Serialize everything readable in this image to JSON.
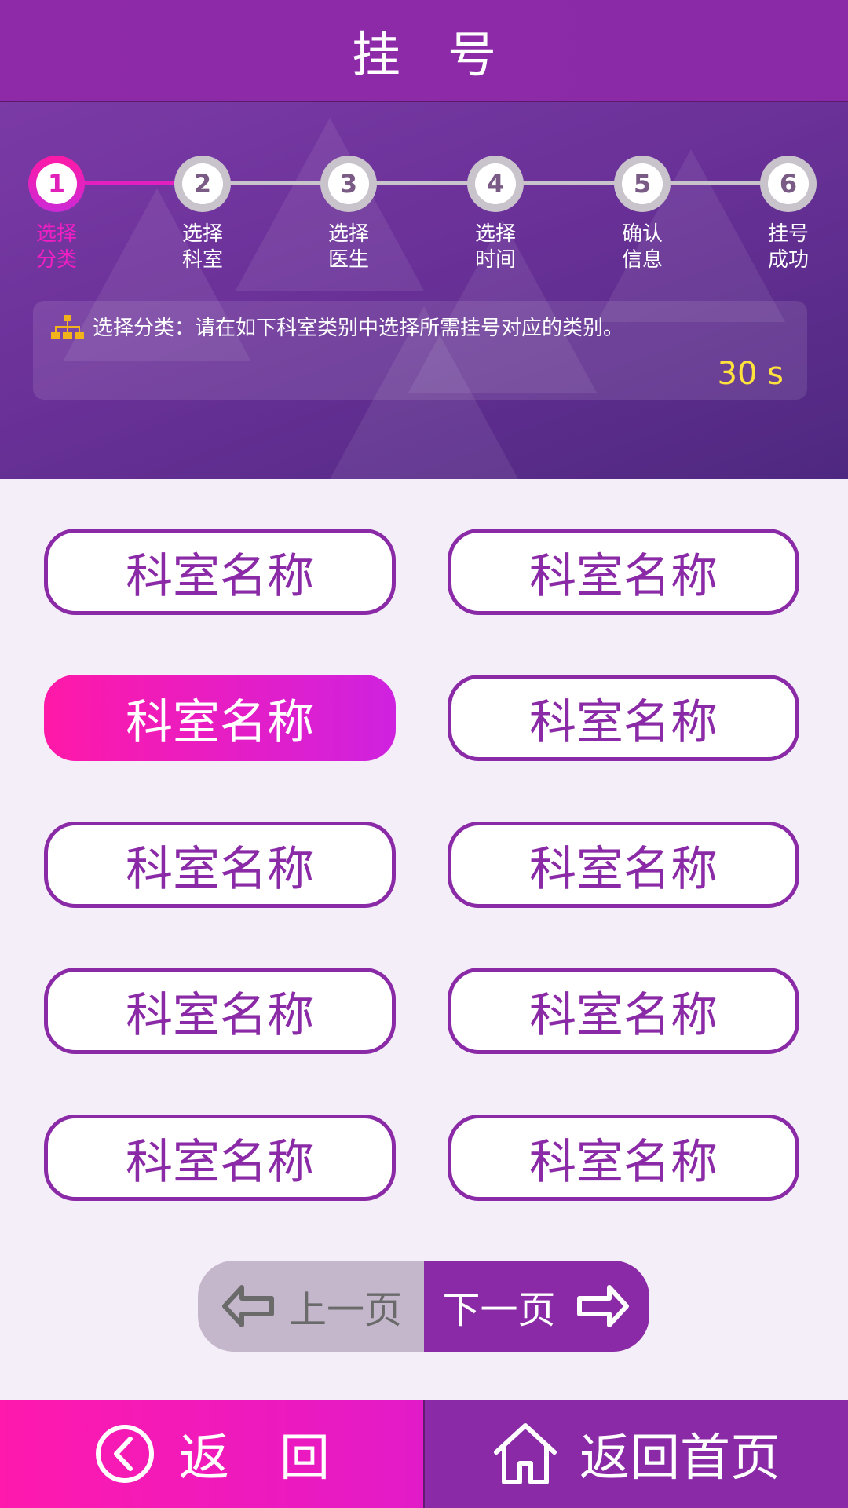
{
  "header": {
    "title": "挂号"
  },
  "steps": [
    {
      "num": "1",
      "label1": "选择",
      "label2": "分类",
      "active": true
    },
    {
      "num": "2",
      "label1": "选择",
      "label2": "科室",
      "active": false
    },
    {
      "num": "3",
      "label1": "选择",
      "label2": "医生",
      "active": false
    },
    {
      "num": "4",
      "label1": "选择",
      "label2": "时间",
      "active": false
    },
    {
      "num": "5",
      "label1": "确认",
      "label2": "信息",
      "active": false
    },
    {
      "num": "6",
      "label1": "挂号",
      "label2": "成功",
      "active": false
    }
  ],
  "info": {
    "text": "选择分类：请在如下科室类别中选择所需挂号对应的类别。",
    "icon": "org-chart-icon",
    "countdown": "30  s"
  },
  "departments": [
    "科室名称",
    "科室名称",
    "科室名称",
    "科室名称",
    "科室名称",
    "科室名称",
    "科室名称",
    "科室名称",
    "科室名称",
    "科室名称"
  ],
  "selected_department_index": 2,
  "pager": {
    "prev": "上一页",
    "next": "下一页"
  },
  "bottom": {
    "back": "返　回",
    "home": "返回首页"
  },
  "colors": {
    "purple": "#8a2aa6",
    "pink": "#ff19a8",
    "countdown": "#ffe23c"
  }
}
